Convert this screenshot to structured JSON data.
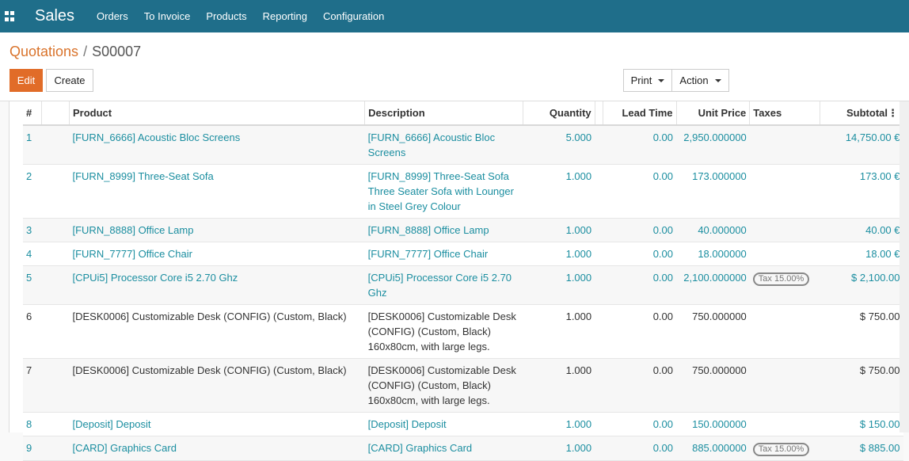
{
  "topbar": {
    "app_title": "Sales",
    "menu": [
      "Orders",
      "To Invoice",
      "Products",
      "Reporting",
      "Configuration"
    ]
  },
  "breadcrumb": {
    "parent": "Quotations",
    "separator": "/",
    "current": "S00007"
  },
  "buttons": {
    "edit": "Edit",
    "create": "Create",
    "print": "Print",
    "action": "Action"
  },
  "table": {
    "headers": {
      "index": "#",
      "product": "Product",
      "description": "Description",
      "quantity": "Quantity",
      "lead_time": "Lead Time",
      "unit_price": "Unit Price",
      "taxes": "Taxes",
      "subtotal": "Subtotal"
    },
    "rows": [
      {
        "index": "1",
        "product": "[FURN_6666] Acoustic Bloc Screens",
        "description": [
          "[FURN_6666] Acoustic Bloc",
          "Screens"
        ],
        "quantity": "5.000",
        "lead_time": "0.00",
        "unit_price": "2,950.000000",
        "taxes": "",
        "subtotal": "14,750.00 €",
        "style": "teal"
      },
      {
        "index": "2",
        "product": "[FURN_8999] Three-Seat Sofa",
        "description": [
          "[FURN_8999] Three-Seat Sofa",
          "Three Seater Sofa with Lounger",
          "in Steel Grey Colour"
        ],
        "quantity": "1.000",
        "lead_time": "0.00",
        "unit_price": "173.000000",
        "taxes": "",
        "subtotal": "173.00 €",
        "style": "teal"
      },
      {
        "index": "3",
        "product": "[FURN_8888] Office Lamp",
        "description": [
          "[FURN_8888] Office Lamp"
        ],
        "quantity": "1.000",
        "lead_time": "0.00",
        "unit_price": "40.000000",
        "taxes": "",
        "subtotal": "40.00 €",
        "style": "teal"
      },
      {
        "index": "4",
        "product": "[FURN_7777] Office Chair",
        "description": [
          "[FURN_7777] Office Chair"
        ],
        "quantity": "1.000",
        "lead_time": "0.00",
        "unit_price": "18.000000",
        "taxes": "",
        "subtotal": "18.00 €",
        "style": "teal"
      },
      {
        "index": "5",
        "product": "[CPUi5] Processor Core i5 2.70 Ghz",
        "description": [
          "[CPUi5] Processor Core i5 2.70",
          "Ghz"
        ],
        "quantity": "1.000",
        "lead_time": "0.00",
        "unit_price": "2,100.000000",
        "taxes": "Tax 15.00%",
        "subtotal": "$ 2,100.00",
        "style": "teal"
      },
      {
        "index": "6",
        "product": "[DESK0006] Customizable Desk (CONFIG) (Custom, Black)",
        "description": [
          "[DESK0006] Customizable Desk",
          "(CONFIG) (Custom, Black)",
          "160x80cm, with large legs."
        ],
        "quantity": "1.000",
        "lead_time": "0.00",
        "unit_price": "750.000000",
        "taxes": "",
        "subtotal": "$ 750.00",
        "style": "dark"
      },
      {
        "index": "7",
        "product": "[DESK0006] Customizable Desk (CONFIG) (Custom, Black)",
        "description": [
          "[DESK0006] Customizable Desk",
          "(CONFIG) (Custom, Black)",
          "160x80cm, with large legs."
        ],
        "quantity": "1.000",
        "lead_time": "0.00",
        "unit_price": "750.000000",
        "taxes": "",
        "subtotal": "$ 750.00",
        "style": "dark"
      },
      {
        "index": "8",
        "product": "[Deposit] Deposit",
        "description": [
          "[Deposit] Deposit"
        ],
        "quantity": "1.000",
        "lead_time": "0.00",
        "unit_price": "150.000000",
        "taxes": "",
        "subtotal": "$ 150.00",
        "style": "teal"
      },
      {
        "index": "9",
        "product": "[CARD] Graphics Card",
        "description": [
          "[CARD] Graphics Card"
        ],
        "quantity": "1.000",
        "lead_time": "0.00",
        "unit_price": "885.000000",
        "taxes": "Tax 15.00%",
        "subtotal": "$ 885.00",
        "style": "teal"
      }
    ]
  },
  "colors": {
    "topbar": "#1f6e8a",
    "accent": "#e16c28",
    "link": "#1b8ea0"
  }
}
